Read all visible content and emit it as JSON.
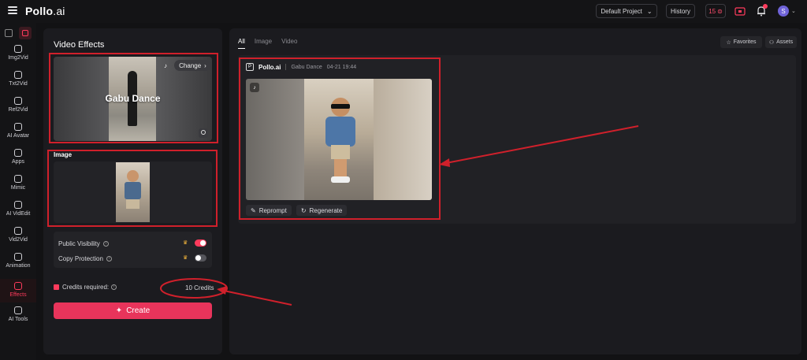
{
  "topbar": {
    "logo_main": "Pollo",
    "logo_suffix": ".ai",
    "project_select": "Default Project",
    "history_label": "History",
    "credits_count": "15",
    "avatar_initial": "S"
  },
  "sidebar": {
    "items": [
      {
        "label": "Img2Vid",
        "icon": "image-to-video-icon"
      },
      {
        "label": "Txt2Vid",
        "icon": "text-to-video-icon"
      },
      {
        "label": "Ref2Vid",
        "icon": "reference-to-video-icon"
      },
      {
        "label": "AI Avatar",
        "icon": "avatar-icon"
      },
      {
        "label": "Apps",
        "icon": "apps-icon"
      },
      {
        "label": "Mimic",
        "icon": "mimic-icon"
      },
      {
        "label": "AI VidEdit",
        "icon": "video-edit-icon"
      },
      {
        "label": "Vid2Vid",
        "icon": "video-to-video-icon"
      },
      {
        "label": "Animation",
        "icon": "animation-icon"
      },
      {
        "label": "Effects",
        "icon": "effects-icon",
        "active": true
      },
      {
        "label": "AI Tools",
        "icon": "tools-icon"
      }
    ]
  },
  "left_panel": {
    "title": "Video Effects",
    "effect_name": "Gabu Dance",
    "change_label": "Change",
    "image_label": "Image",
    "public_visibility_label": "Public Visibility",
    "public_visibility_on": true,
    "copy_protection_label": "Copy Protection",
    "copy_protection_on": false,
    "credits_required_label": "Credits required:",
    "credits_value": "10 Credits",
    "create_label": "Create"
  },
  "main": {
    "tabs": [
      {
        "label": "All",
        "active": true
      },
      {
        "label": "Image",
        "active": false
      },
      {
        "label": "Video",
        "active": false
      }
    ],
    "favorites_label": "Favorites",
    "assets_label": "Assets",
    "card": {
      "brand": "Pollo.ai",
      "effect": "Gabu Dance",
      "timestamp": "04-21 19:44",
      "reprompt_label": "Reprompt",
      "regenerate_label": "Regenerate"
    }
  },
  "colors": {
    "accent": "#e8345b",
    "annotation": "#d0202b",
    "background": "#121214",
    "panel": "#1b1b1f"
  }
}
